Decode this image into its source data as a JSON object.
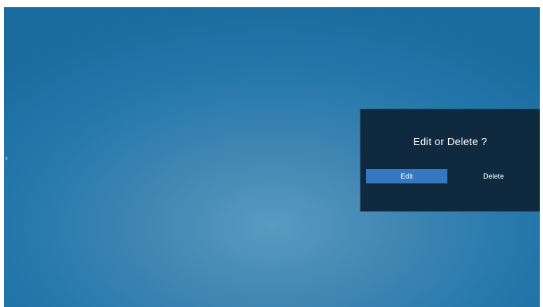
{
  "dialog": {
    "title": "Edit or Delete ?",
    "edit_label": "Edit",
    "delete_label": "Delete"
  },
  "nav": {
    "left_arrow": "›",
    "right_arrow": "‹"
  },
  "colors": {
    "background_accent": "#2377aa",
    "dialog_bg": "#0f2a3e",
    "selected_button": "#3478c0"
  }
}
